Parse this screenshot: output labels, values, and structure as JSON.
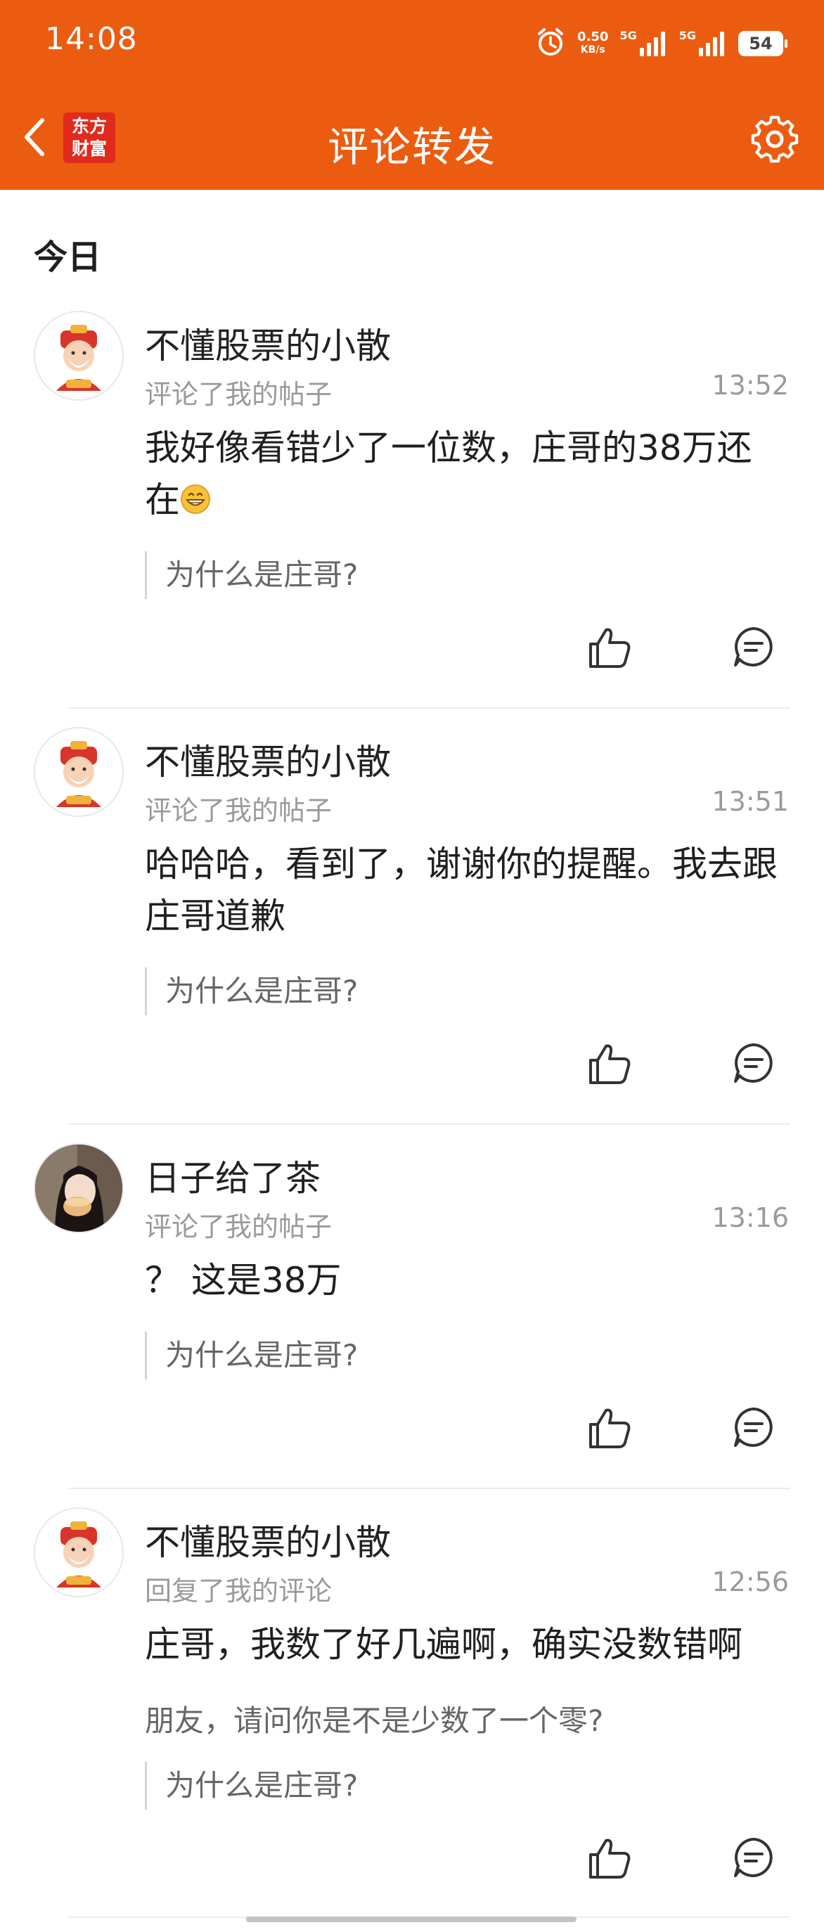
{
  "status_bar": {
    "time": "14:08",
    "net_speed_value": "0.50",
    "net_speed_unit": "KB/s",
    "signal1_label": "5G",
    "signal2_label": "5G",
    "battery": "54",
    "icons": [
      "alarm-icon",
      "signal-icon",
      "signal-icon",
      "battery-icon"
    ]
  },
  "nav": {
    "logo_line1": "东方",
    "logo_line2": "财富",
    "title": "评论转发"
  },
  "section": {
    "date_label": "今日"
  },
  "comments": [
    {
      "user": "不懂股票的小散",
      "action": "评论了我的帖子",
      "time": "13:52",
      "text": "我好像看错少了一位数，庄哥的38万还在",
      "emoji": "grinning-face",
      "quote": "为什么是庄哥?"
    },
    {
      "user": "不懂股票的小散",
      "action": "评论了我的帖子",
      "time": "13:51",
      "text": "哈哈哈，看到了，谢谢你的提醒。我去跟庄哥道歉",
      "quote": "为什么是庄哥?"
    },
    {
      "user": "日子给了茶",
      "action": "评论了我的帖子",
      "time": "13:16",
      "text": "？ 这是38万",
      "quote": "为什么是庄哥?"
    },
    {
      "user": "不懂股票的小散",
      "action": "回复了我的评论",
      "time": "12:56",
      "text": "庄哥，我数了好几遍啊，确实没数错啊",
      "replied_to": "朋友，请问你是不是少数了一个零?",
      "quote": "为什么是庄哥?"
    }
  ],
  "colors": {
    "brand_orange": "#eb5c10",
    "logo_red": "#e12a1c",
    "text_primary": "#1f1f1f",
    "text_secondary": "#9a9a9a"
  }
}
